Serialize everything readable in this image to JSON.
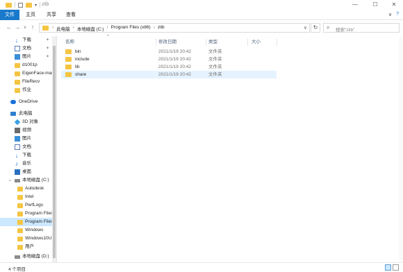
{
  "window": {
    "title": "zlib",
    "controls": {
      "minimize": "—",
      "maximize": "☐",
      "close": "✕"
    }
  },
  "ribbon": {
    "tabs": [
      {
        "label": "文件",
        "active": true
      },
      {
        "label": "主页",
        "active": false
      },
      {
        "label": "共享",
        "active": false
      },
      {
        "label": "查看",
        "active": false
      }
    ],
    "expand_glyph": "∨",
    "help_glyph": "?"
  },
  "address_bar": {
    "back": "←",
    "forward": "→",
    "recent": "∨",
    "up": "↑",
    "breadcrumbs": [
      "此电脑",
      "本地磁盘 (C:)",
      "Program Files (x86)",
      "zlib"
    ],
    "separator": "›",
    "dropdown": "∨",
    "refresh": "↻",
    "search_placeholder": "搜索\"zlib\""
  },
  "nav_pane": {
    "items": [
      {
        "label": "下载",
        "icon": "download-icon",
        "pinned": true
      },
      {
        "label": "文档",
        "icon": "document-icon",
        "pinned": true
      },
      {
        "label": "图片",
        "icon": "pictures-icon",
        "pinned": true
      },
      {
        "label": "d1001p",
        "icon": "folder-icon"
      },
      {
        "label": "EigenFace-mas",
        "icon": "folder-icon"
      },
      {
        "label": "FileRecv",
        "icon": "folder-icon"
      },
      {
        "label": "作业",
        "icon": "folder-icon"
      },
      {
        "label": "OneDrive",
        "icon": "onedrive-icon"
      },
      {
        "label": "此电脑",
        "icon": "this-pc-icon"
      },
      {
        "label": "3D 对象",
        "icon": "3d-objects-icon"
      },
      {
        "label": "视频",
        "icon": "videos-icon"
      },
      {
        "label": "图片",
        "icon": "pictures-icon"
      },
      {
        "label": "文档",
        "icon": "document-icon"
      },
      {
        "label": "下载",
        "icon": "download-icon"
      },
      {
        "label": "音乐",
        "icon": "music-icon"
      },
      {
        "label": "桌面",
        "icon": "desktop-icon"
      },
      {
        "label": "本地磁盘 (C:)",
        "icon": "drive-icon"
      },
      {
        "label": "Autodesk",
        "icon": "folder-icon"
      },
      {
        "label": "Intel",
        "icon": "folder-icon"
      },
      {
        "label": "PerfLogs",
        "icon": "folder-icon"
      },
      {
        "label": "Program Files",
        "icon": "folder-icon"
      },
      {
        "label": "Program Files",
        "icon": "folder-icon",
        "selected": true
      },
      {
        "label": "Windows",
        "icon": "folder-icon"
      },
      {
        "label": "Windows10U",
        "icon": "folder-icon"
      },
      {
        "label": "用户",
        "icon": "folder-icon"
      },
      {
        "label": "本地磁盘 (D:)",
        "icon": "drive-icon"
      }
    ],
    "pin_glyph": "📌"
  },
  "file_list": {
    "columns": {
      "name": "名称",
      "modified": "修改日期",
      "type": "类型",
      "size": "大小"
    },
    "sort_glyph": "^",
    "rows": [
      {
        "name": "bin",
        "modified": "2021/1/19 20:42",
        "type": "文件夹"
      },
      {
        "name": "include",
        "modified": "2021/1/19 20:42",
        "type": "文件夹"
      },
      {
        "name": "lib",
        "modified": "2021/1/19 20:42",
        "type": "文件夹"
      },
      {
        "name": "share",
        "modified": "2021/1/19 20:42",
        "type": "文件夹",
        "hover": true
      }
    ]
  },
  "status_bar": {
    "count": "4 个项目"
  }
}
